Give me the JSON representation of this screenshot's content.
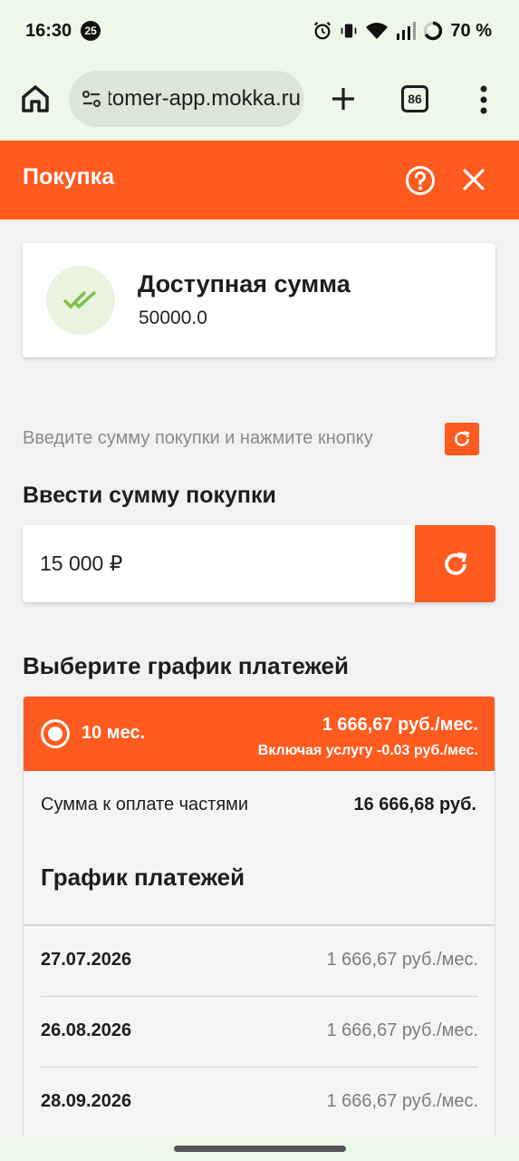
{
  "status_bar": {
    "time": "16:30",
    "notification_count": "25",
    "battery": "70 %"
  },
  "browser": {
    "url": "customer-app.mokka.ru",
    "tab_count": "86"
  },
  "header": {
    "title": "Покупка"
  },
  "balance": {
    "title": "Доступная сумма",
    "value": "50000.0"
  },
  "hint": {
    "text": "Введите сумму покупки и нажмите кнопку"
  },
  "amount": {
    "label": "Ввести сумму покупки",
    "value": "15 000 ₽"
  },
  "schedule": {
    "title": "Выберите график платежей",
    "plan": {
      "months": "10 мес.",
      "monthly_payment": "1 666,67 руб./мес.",
      "service_note": "Включая услугу -0.03 руб./мес.",
      "total_label": "Сумма к оплате частями",
      "total_value": "16 666,68 руб.",
      "payments_title": "График платежей",
      "payments": [
        {
          "date": "27.07.2026",
          "amount": "1 666,67 руб./мес."
        },
        {
          "date": "26.08.2026",
          "amount": "1 666,67 руб./мес."
        },
        {
          "date": "28.09.2026",
          "amount": "1 666,67 руб./мес."
        }
      ]
    }
  },
  "colors": {
    "accent": "#ff5a1f",
    "status_bg": "#eef8e8",
    "check_green": "#7cc24a"
  }
}
